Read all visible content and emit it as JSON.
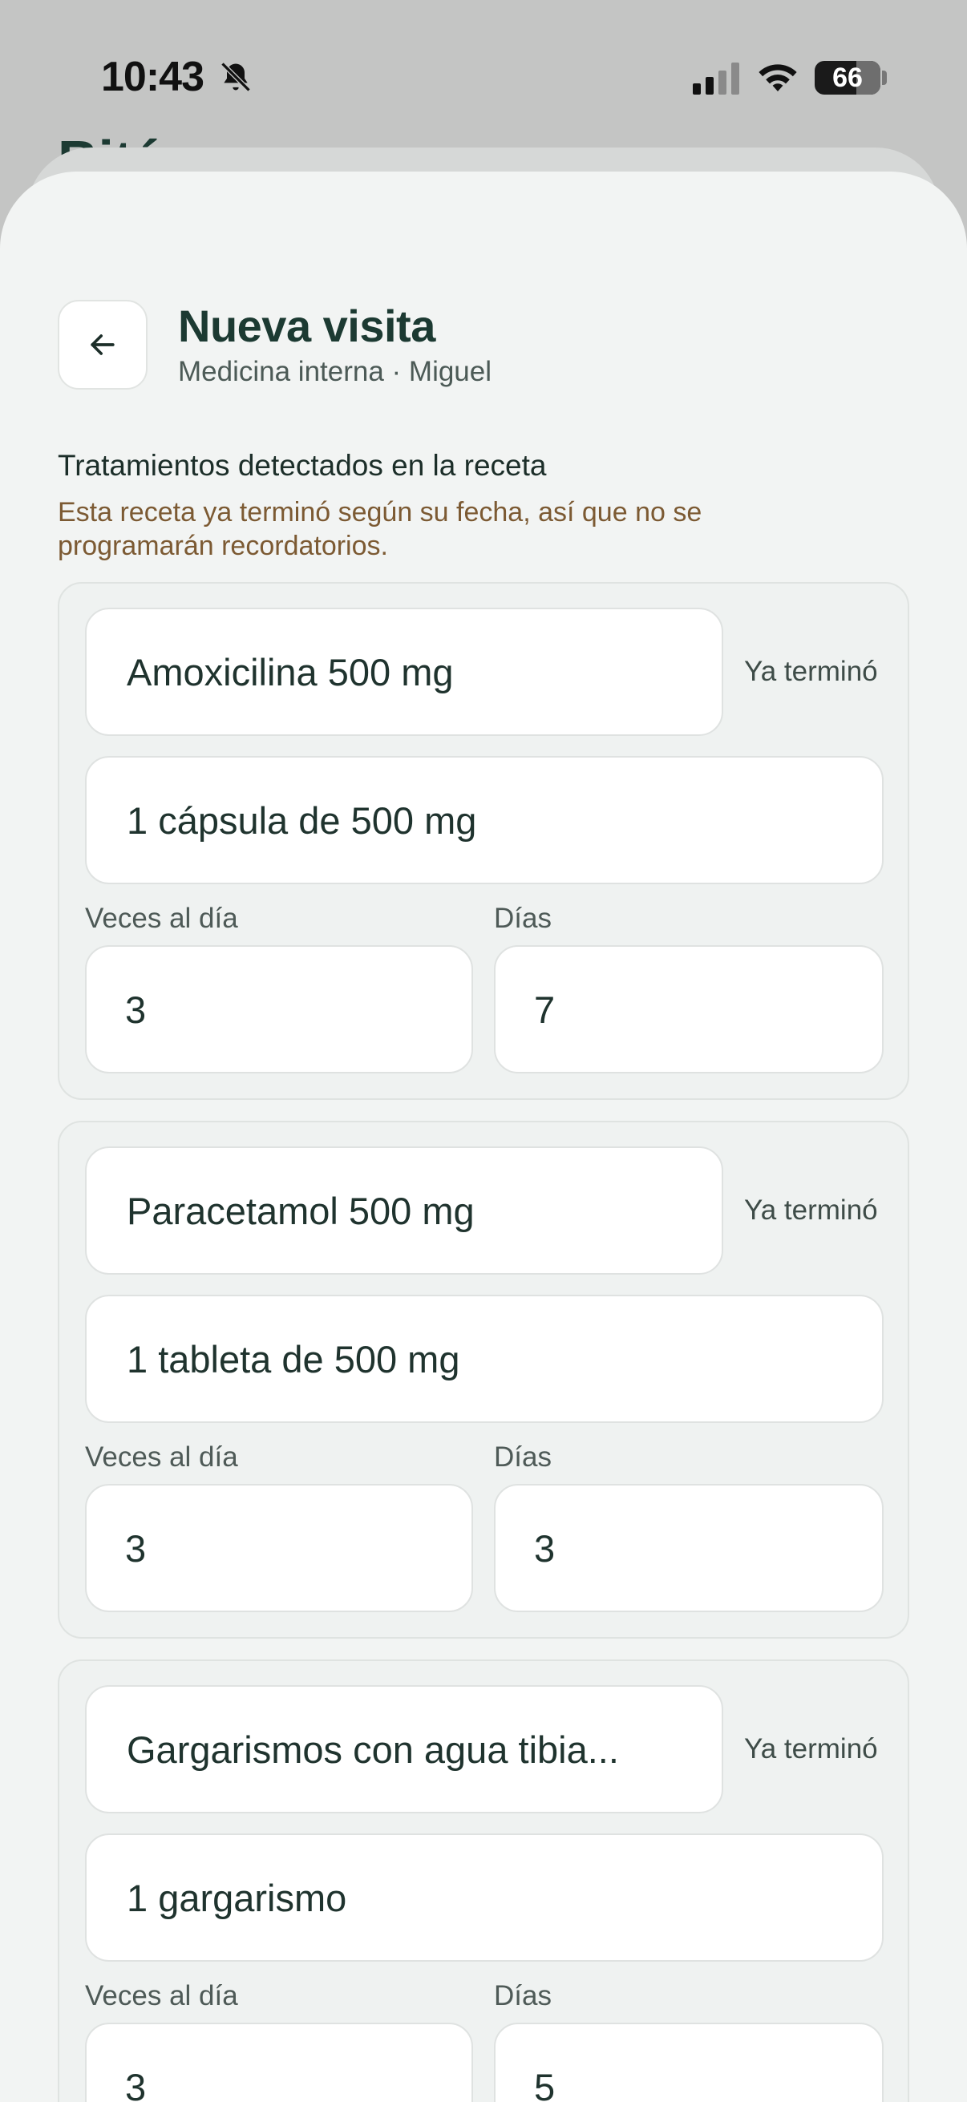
{
  "status_bar": {
    "time": "10:43",
    "battery": "66"
  },
  "background": {
    "title": "Bitá"
  },
  "header": {
    "title": "Nueva visita",
    "subtitle": "Medicina interna · Miguel"
  },
  "section": {
    "title": "Tratamientos detectados en la receta",
    "note": "Esta receta ya terminó según su fecha, así que no se programarán recordatorios."
  },
  "labels": {
    "times_per_day": "Veces al día",
    "days": "Días"
  },
  "treatments": [
    {
      "name": "Amoxicilina 500 mg",
      "status": "Ya terminó",
      "dose": "1 cápsula de 500 mg",
      "times_per_day": "3",
      "days": "7"
    },
    {
      "name": "Paracetamol 500 mg",
      "status": "Ya terminó",
      "dose": "1 tableta de 500 mg",
      "times_per_day": "3",
      "days": "3"
    },
    {
      "name": "Gargarismos con agua tibia...",
      "status": "Ya terminó",
      "dose": "1 gargarismo",
      "times_per_day": "3",
      "days": "5"
    }
  ],
  "colors": {
    "accent_dark": "#1c3a32",
    "warning_text": "#7c5a33",
    "sheet_bg": "#f2f4f3"
  }
}
